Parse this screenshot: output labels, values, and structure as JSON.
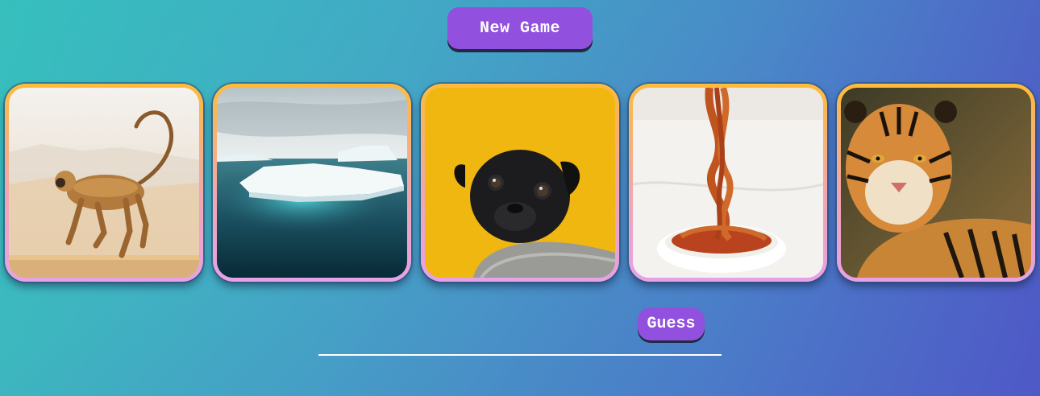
{
  "header": {
    "new_game_label": "New Game"
  },
  "cards": [
    {
      "subject": "monkey"
    },
    {
      "subject": "iceberg"
    },
    {
      "subject": "pug"
    },
    {
      "subject": "spaghetti"
    },
    {
      "subject": "tiger"
    }
  ],
  "guess": {
    "button_label": "Guess",
    "input_value": ""
  },
  "colors": {
    "accent": "#9150de",
    "background_start": "#3bbcbd",
    "background_end": "#4e5fc6",
    "card_border_top": "#ffbb3a",
    "card_border_bottom": "#e6a1e9"
  }
}
